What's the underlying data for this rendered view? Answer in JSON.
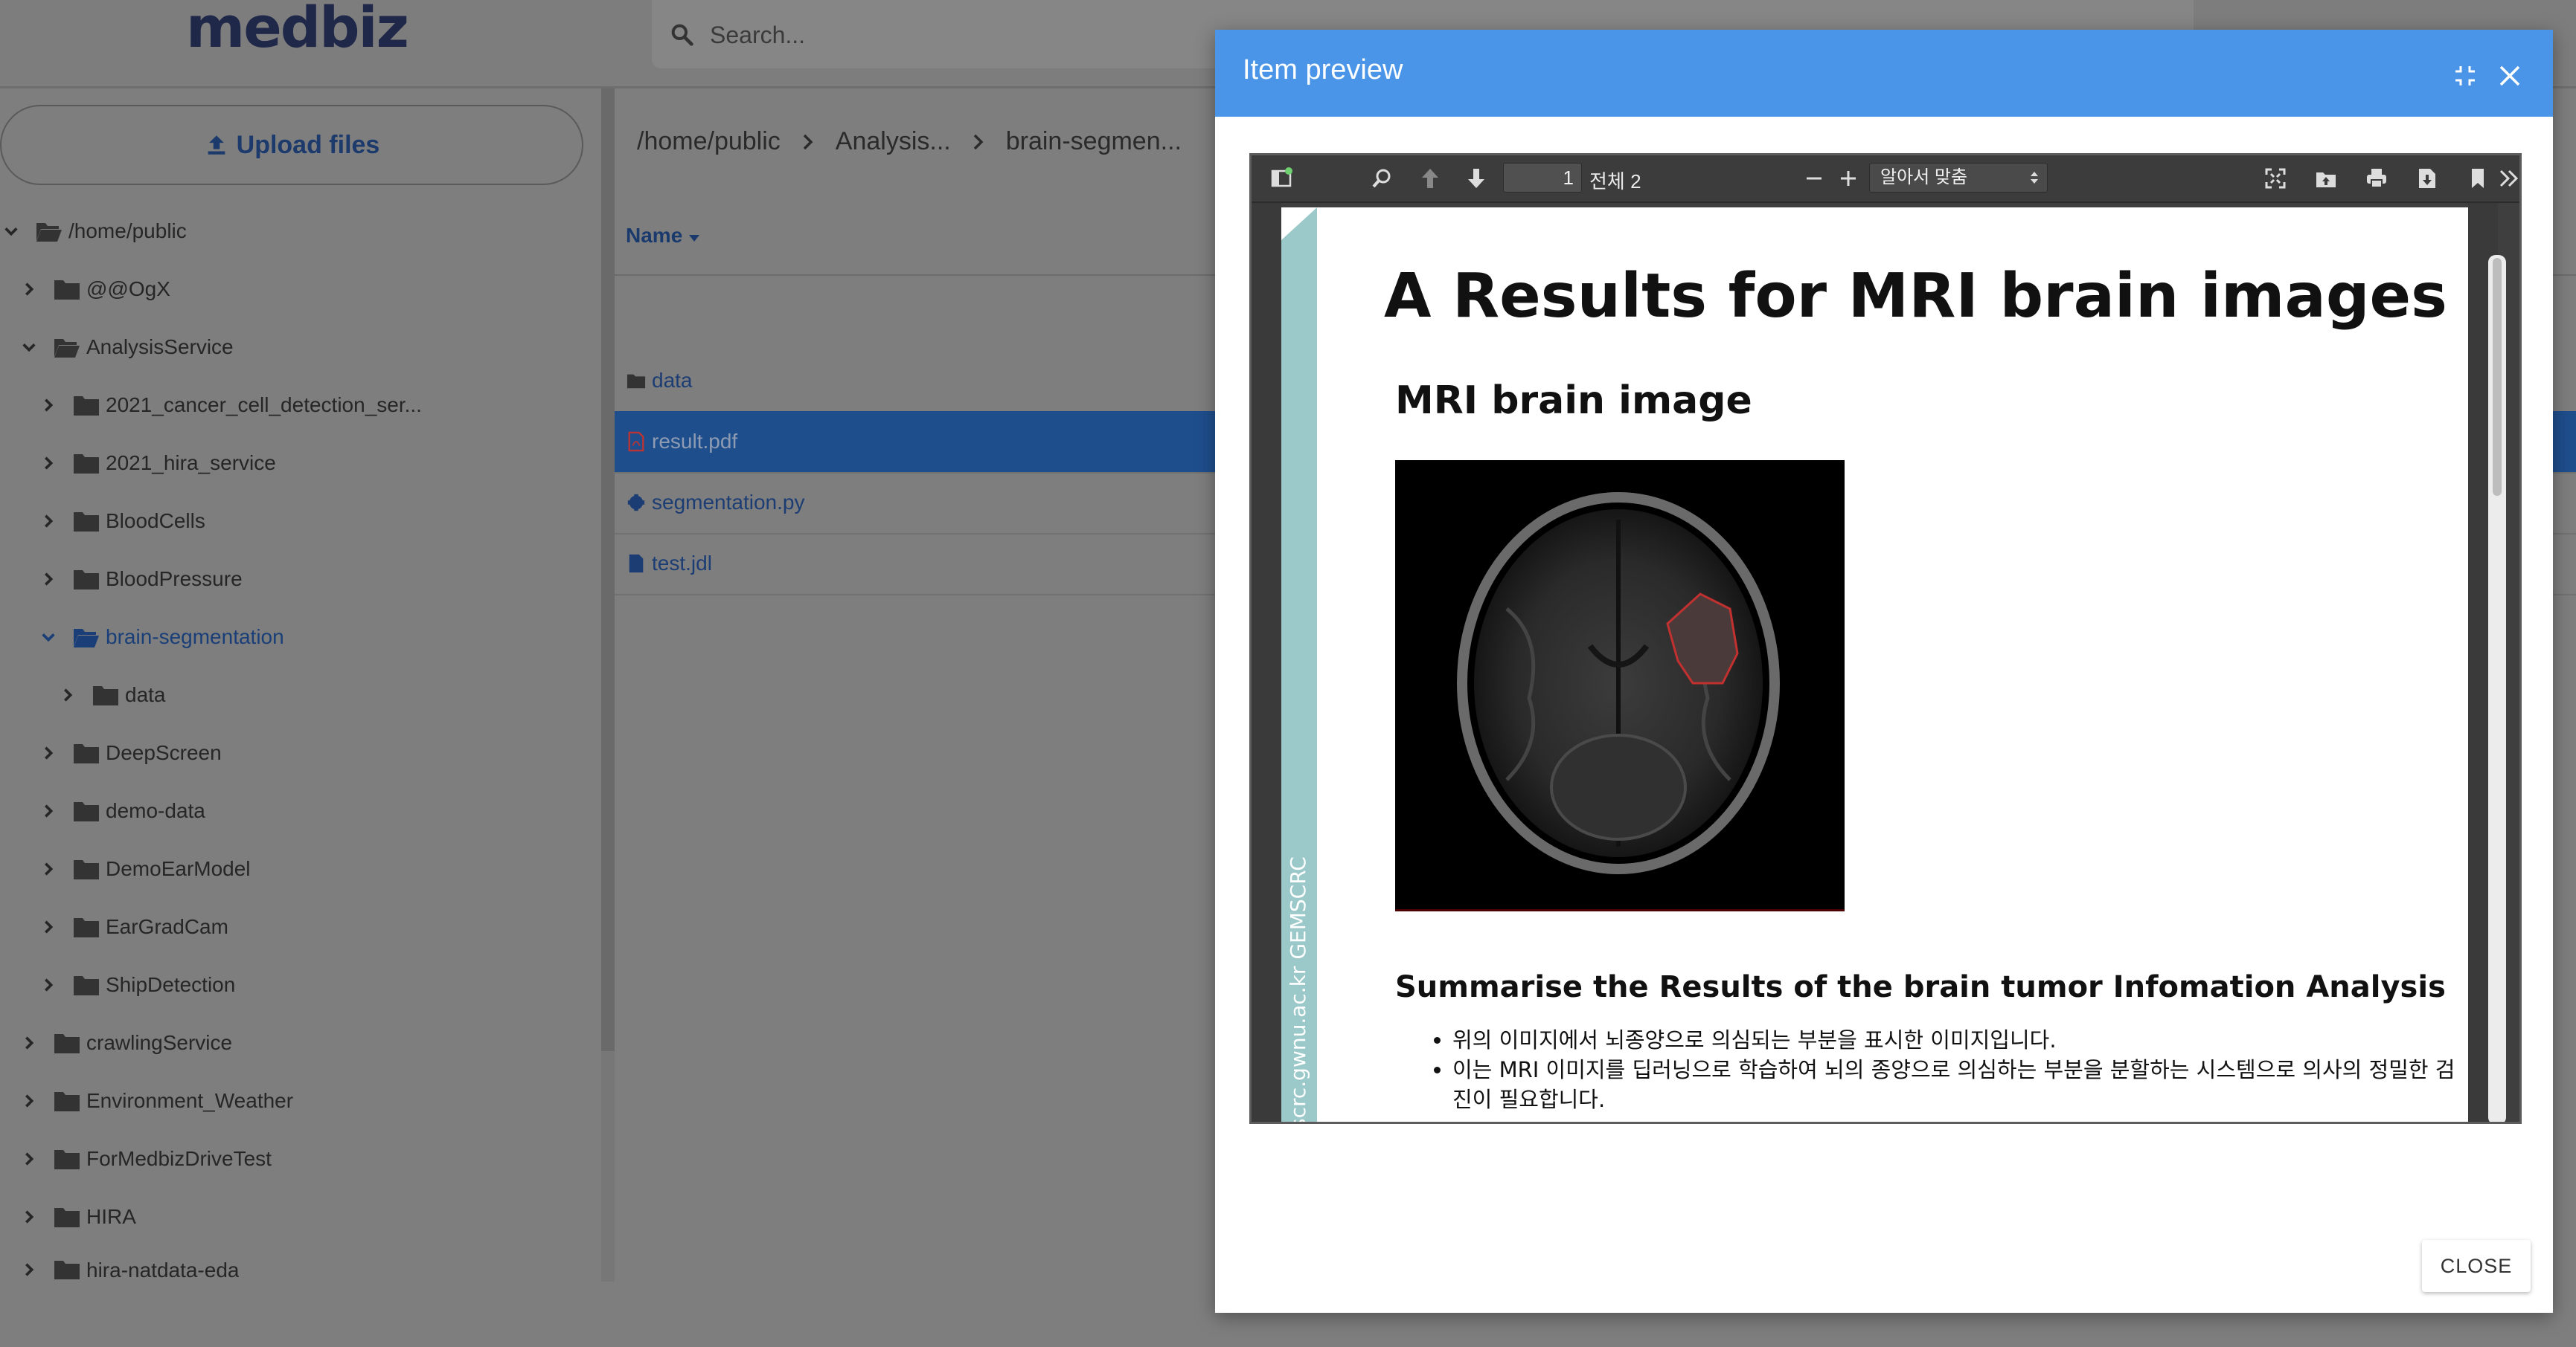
{
  "app": {
    "logo": "medbiz",
    "search": {
      "placeholder": "Search..."
    },
    "upload_label": "Upload files"
  },
  "tree": [
    {
      "label": "/home/public"
    },
    {
      "label": "@@OgX"
    },
    {
      "label": "AnalysisService"
    },
    {
      "label": "2021_cancer_cell_detection_ser..."
    },
    {
      "label": "2021_hira_service"
    },
    {
      "label": "BloodCells"
    },
    {
      "label": "BloodPressure"
    },
    {
      "label": "brain-segmentation"
    },
    {
      "label": "data"
    },
    {
      "label": "DeepScreen"
    },
    {
      "label": "demo-data"
    },
    {
      "label": "DemoEarModel"
    },
    {
      "label": "EarGradCam"
    },
    {
      "label": "ShipDetection"
    },
    {
      "label": "crawlingService"
    },
    {
      "label": "Environment_Weather"
    },
    {
      "label": "ForMedbizDriveTest"
    },
    {
      "label": "HIRA"
    },
    {
      "label": "hira-natdata-eda"
    }
  ],
  "breadcrumb": [
    "/home/public",
    "Analysis...",
    "brain-segmen..."
  ],
  "table": {
    "name_header": "Name",
    "files": [
      {
        "name": "data"
      },
      {
        "name": "result.pdf"
      },
      {
        "name": "segmentation.py"
      },
      {
        "name": "test.jdl"
      }
    ]
  },
  "dialog": {
    "title": "Item preview",
    "close_label": "CLOSE",
    "viewer": {
      "page_number": "1",
      "page_total": "전체 2",
      "zoom": "알아서 맞춤"
    },
    "pdf": {
      "title": "A Results for MRI brain images",
      "heading": "MRI brain image",
      "subheading": "Summarise the Results of the brain tumor Infomation Analysis",
      "bullets": [
        "위의 이미지에서 뇌종양으로 의심되는 부분을 표시한 이미지입니다.",
        "이는 MRI 이미지를 딥러닝으로 학습하여 뇌의 종양으로 의심하는 부분을 분할하는 시스템으로 의사의 정밀한 검진이 필요합니다."
      ],
      "side_text": "scrc.gwnu.ac.kr GEMSCRC"
    }
  }
}
